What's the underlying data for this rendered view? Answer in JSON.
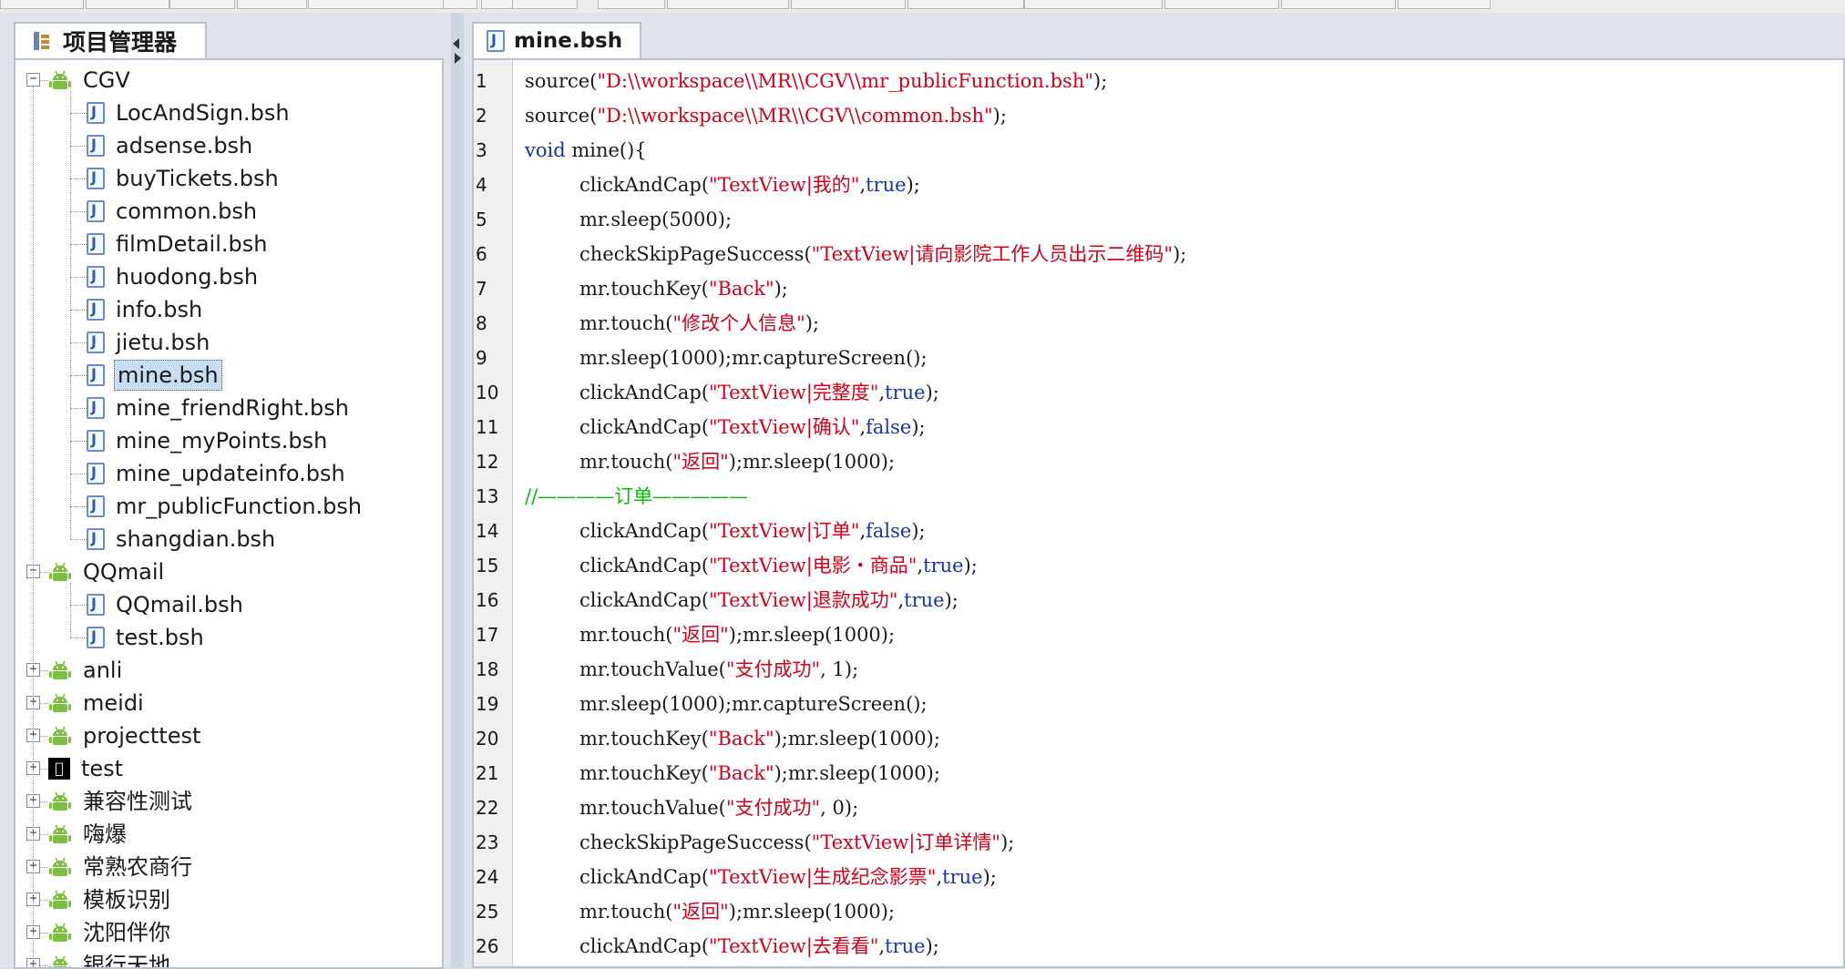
{
  "left_panel": {
    "tab_label": "项目管理器"
  },
  "tree": [
    {
      "label": "CGV",
      "type": "android",
      "level": 0,
      "expander": "−"
    },
    {
      "label": "LocAndSign.bsh",
      "type": "file",
      "level": 1
    },
    {
      "label": "adsense.bsh",
      "type": "file",
      "level": 1
    },
    {
      "label": "buyTickets.bsh",
      "type": "file",
      "level": 1
    },
    {
      "label": "common.bsh",
      "type": "file",
      "level": 1
    },
    {
      "label": "filmDetail.bsh",
      "type": "file",
      "level": 1
    },
    {
      "label": "huodong.bsh",
      "type": "file",
      "level": 1
    },
    {
      "label": "info.bsh",
      "type": "file",
      "level": 1
    },
    {
      "label": "jietu.bsh",
      "type": "file",
      "level": 1
    },
    {
      "label": "mine.bsh",
      "type": "file",
      "level": 1,
      "selected": true
    },
    {
      "label": "mine_friendRight.bsh",
      "type": "file",
      "level": 1
    },
    {
      "label": "mine_myPoints.bsh",
      "type": "file",
      "level": 1
    },
    {
      "label": "mine_updateinfo.bsh",
      "type": "file",
      "level": 1
    },
    {
      "label": "mr_publicFunction.bsh",
      "type": "file",
      "level": 1
    },
    {
      "label": "shangdian.bsh",
      "type": "file",
      "level": 1
    },
    {
      "label": "QQmail",
      "type": "android",
      "level": 0,
      "expander": "−"
    },
    {
      "label": "QQmail.bsh",
      "type": "file",
      "level": 1
    },
    {
      "label": "test.bsh",
      "type": "file",
      "level": 1
    },
    {
      "label": "anli",
      "type": "android",
      "level": 0,
      "expander": "+"
    },
    {
      "label": "meidi",
      "type": "android",
      "level": 0,
      "expander": "+"
    },
    {
      "label": "projecttest",
      "type": "android",
      "level": 0,
      "expander": "+"
    },
    {
      "label": "test",
      "type": "apple",
      "level": 0,
      "expander": "+"
    },
    {
      "label": "兼容性测试",
      "type": "android",
      "level": 0,
      "expander": "+"
    },
    {
      "label": "嗨爆",
      "type": "android",
      "level": 0,
      "expander": "+"
    },
    {
      "label": "常熟农商行",
      "type": "android",
      "level": 0,
      "expander": "+"
    },
    {
      "label": "模板识别",
      "type": "android",
      "level": 0,
      "expander": "+"
    },
    {
      "label": "沈阳伴你",
      "type": "android",
      "level": 0,
      "expander": "+"
    },
    {
      "label": "银行天地",
      "type": "android",
      "level": 0,
      "expander": "+"
    }
  ],
  "editor": {
    "tab_label": "mine.bsh",
    "lines": [
      {
        "n": "1",
        "indent": false,
        "tokens": [
          [
            "source(",
            "plain"
          ],
          [
            "\"D:\\\\workspace\\\\MR\\\\CGV\\\\mr_publicFunction.bsh\"",
            "str"
          ],
          [
            ");",
            "plain"
          ]
        ]
      },
      {
        "n": "2",
        "indent": false,
        "tokens": [
          [
            "source(",
            "plain"
          ],
          [
            "\"D:\\\\workspace\\\\MR\\\\CGV\\\\common.bsh\"",
            "str"
          ],
          [
            ");",
            "plain"
          ]
        ]
      },
      {
        "n": "3",
        "indent": false,
        "tokens": [
          [
            "void",
            "kw"
          ],
          [
            " mine(){",
            "plain"
          ]
        ]
      },
      {
        "n": "4",
        "indent": true,
        "tokens": [
          [
            "clickAndCap(",
            "plain"
          ],
          [
            "\"TextView|我的\"",
            "str"
          ],
          [
            ",",
            "plain"
          ],
          [
            "true",
            "kw"
          ],
          [
            ");",
            "plain"
          ]
        ]
      },
      {
        "n": "5",
        "indent": true,
        "tokens": [
          [
            "mr.",
            "obj"
          ],
          [
            "sleep(5000);",
            "plain"
          ]
        ]
      },
      {
        "n": "6",
        "indent": true,
        "tokens": [
          [
            "checkSkipPageSuccess(",
            "plain"
          ],
          [
            "\"TextView|请向影院工作人员出示二维码\"",
            "str"
          ],
          [
            ");",
            "plain"
          ]
        ]
      },
      {
        "n": "7",
        "indent": true,
        "tokens": [
          [
            "mr.",
            "obj"
          ],
          [
            "touchKey(",
            "plain"
          ],
          [
            "\"Back\"",
            "str"
          ],
          [
            ");",
            "plain"
          ]
        ]
      },
      {
        "n": "8",
        "indent": true,
        "tokens": [
          [
            "mr.",
            "obj"
          ],
          [
            "touch(",
            "plain"
          ],
          [
            "\"修改个人信息\"",
            "str"
          ],
          [
            ");",
            "plain"
          ]
        ]
      },
      {
        "n": "9",
        "indent": true,
        "tokens": [
          [
            "mr.",
            "obj"
          ],
          [
            "sleep(1000);",
            "plain"
          ],
          [
            "mr.",
            "obj"
          ],
          [
            "captureScreen();",
            "plain"
          ]
        ]
      },
      {
        "n": "10",
        "indent": true,
        "tokens": [
          [
            "clickAndCap(",
            "plain"
          ],
          [
            "\"TextView|完整度\"",
            "str"
          ],
          [
            ",",
            "plain"
          ],
          [
            "true",
            "kw"
          ],
          [
            ");",
            "plain"
          ]
        ]
      },
      {
        "n": "11",
        "indent": true,
        "tokens": [
          [
            "clickAndCap(",
            "plain"
          ],
          [
            "\"TextView|确认\"",
            "str"
          ],
          [
            ",",
            "plain"
          ],
          [
            "false",
            "kw"
          ],
          [
            ");",
            "plain"
          ]
        ]
      },
      {
        "n": "12",
        "indent": true,
        "tokens": [
          [
            "mr.",
            "obj"
          ],
          [
            "touch(",
            "plain"
          ],
          [
            "\"返回\"",
            "str"
          ],
          [
            ");",
            "plain"
          ],
          [
            "mr.",
            "obj"
          ],
          [
            "sleep(1000);",
            "plain"
          ]
        ]
      },
      {
        "n": "13",
        "indent": false,
        "tokens": [
          [
            "//————订单—————",
            "comment"
          ]
        ]
      },
      {
        "n": "14",
        "indent": true,
        "tokens": [
          [
            "clickAndCap(",
            "plain"
          ],
          [
            "\"TextView|订单\"",
            "str"
          ],
          [
            ",",
            "plain"
          ],
          [
            "false",
            "kw"
          ],
          [
            ");",
            "plain"
          ]
        ]
      },
      {
        "n": "15",
        "indent": true,
        "tokens": [
          [
            "clickAndCap(",
            "plain"
          ],
          [
            "\"TextView|电影・商品\"",
            "str"
          ],
          [
            ",",
            "plain"
          ],
          [
            "true",
            "kw"
          ],
          [
            ");",
            "plain"
          ]
        ]
      },
      {
        "n": "16",
        "indent": true,
        "tokens": [
          [
            "clickAndCap(",
            "plain"
          ],
          [
            "\"TextView|退款成功\"",
            "str"
          ],
          [
            ",",
            "plain"
          ],
          [
            "true",
            "kw"
          ],
          [
            ");",
            "plain"
          ]
        ]
      },
      {
        "n": "17",
        "indent": true,
        "tokens": [
          [
            "mr.",
            "obj"
          ],
          [
            "touch(",
            "plain"
          ],
          [
            "\"返回\"",
            "str"
          ],
          [
            ");",
            "plain"
          ],
          [
            "mr.",
            "obj"
          ],
          [
            "sleep(1000);",
            "plain"
          ]
        ]
      },
      {
        "n": "18",
        "indent": true,
        "tokens": [
          [
            "mr.",
            "obj"
          ],
          [
            "touchValue(",
            "plain"
          ],
          [
            "\"支付成功\"",
            "str"
          ],
          [
            ", 1);",
            "plain"
          ]
        ]
      },
      {
        "n": "19",
        "indent": true,
        "tokens": [
          [
            "mr.",
            "obj"
          ],
          [
            "sleep(1000);",
            "plain"
          ],
          [
            "mr.",
            "obj"
          ],
          [
            "captureScreen();",
            "plain"
          ]
        ]
      },
      {
        "n": "20",
        "indent": true,
        "tokens": [
          [
            "mr.",
            "obj"
          ],
          [
            "touchKey(",
            "plain"
          ],
          [
            "\"Back\"",
            "str"
          ],
          [
            ");",
            "plain"
          ],
          [
            "mr.",
            "obj"
          ],
          [
            "sleep(1000);",
            "plain"
          ]
        ]
      },
      {
        "n": "21",
        "indent": true,
        "tokens": [
          [
            "mr.",
            "obj"
          ],
          [
            "touchKey(",
            "plain"
          ],
          [
            "\"Back\"",
            "str"
          ],
          [
            ");",
            "plain"
          ],
          [
            "mr.",
            "obj"
          ],
          [
            "sleep(1000);",
            "plain"
          ]
        ]
      },
      {
        "n": "22",
        "indent": true,
        "tokens": [
          [
            "mr.",
            "obj"
          ],
          [
            "touchValue(",
            "plain"
          ],
          [
            "\"支付成功\"",
            "str"
          ],
          [
            ", 0);",
            "plain"
          ]
        ]
      },
      {
        "n": "23",
        "indent": true,
        "tokens": [
          [
            "checkSkipPageSuccess(",
            "plain"
          ],
          [
            "\"TextView|订单详情\"",
            "str"
          ],
          [
            ");",
            "plain"
          ]
        ]
      },
      {
        "n": "24",
        "indent": true,
        "tokens": [
          [
            "clickAndCap(",
            "plain"
          ],
          [
            "\"TextView|生成纪念影票\"",
            "str"
          ],
          [
            ",",
            "plain"
          ],
          [
            "true",
            "kw"
          ],
          [
            ");",
            "plain"
          ]
        ]
      },
      {
        "n": "25",
        "indent": true,
        "tokens": [
          [
            "mr.",
            "obj"
          ],
          [
            "touch(",
            "plain"
          ],
          [
            "\"返回\"",
            "str"
          ],
          [
            ");",
            "plain"
          ],
          [
            "mr.",
            "obj"
          ],
          [
            "sleep(1000);",
            "plain"
          ]
        ]
      },
      {
        "n": "26",
        "indent": true,
        "tokens": [
          [
            "clickAndCap(",
            "plain"
          ],
          [
            "\"TextView|去看看\"",
            "str"
          ],
          [
            ",",
            "plain"
          ],
          [
            "true",
            "kw"
          ],
          [
            ");",
            "plain"
          ]
        ]
      }
    ]
  },
  "colors": {
    "string": "#d4001a",
    "keyword": "#1633a8",
    "comment": "#00c000",
    "android_green": "#7fbf3f",
    "selection": "#c8dcf2"
  }
}
